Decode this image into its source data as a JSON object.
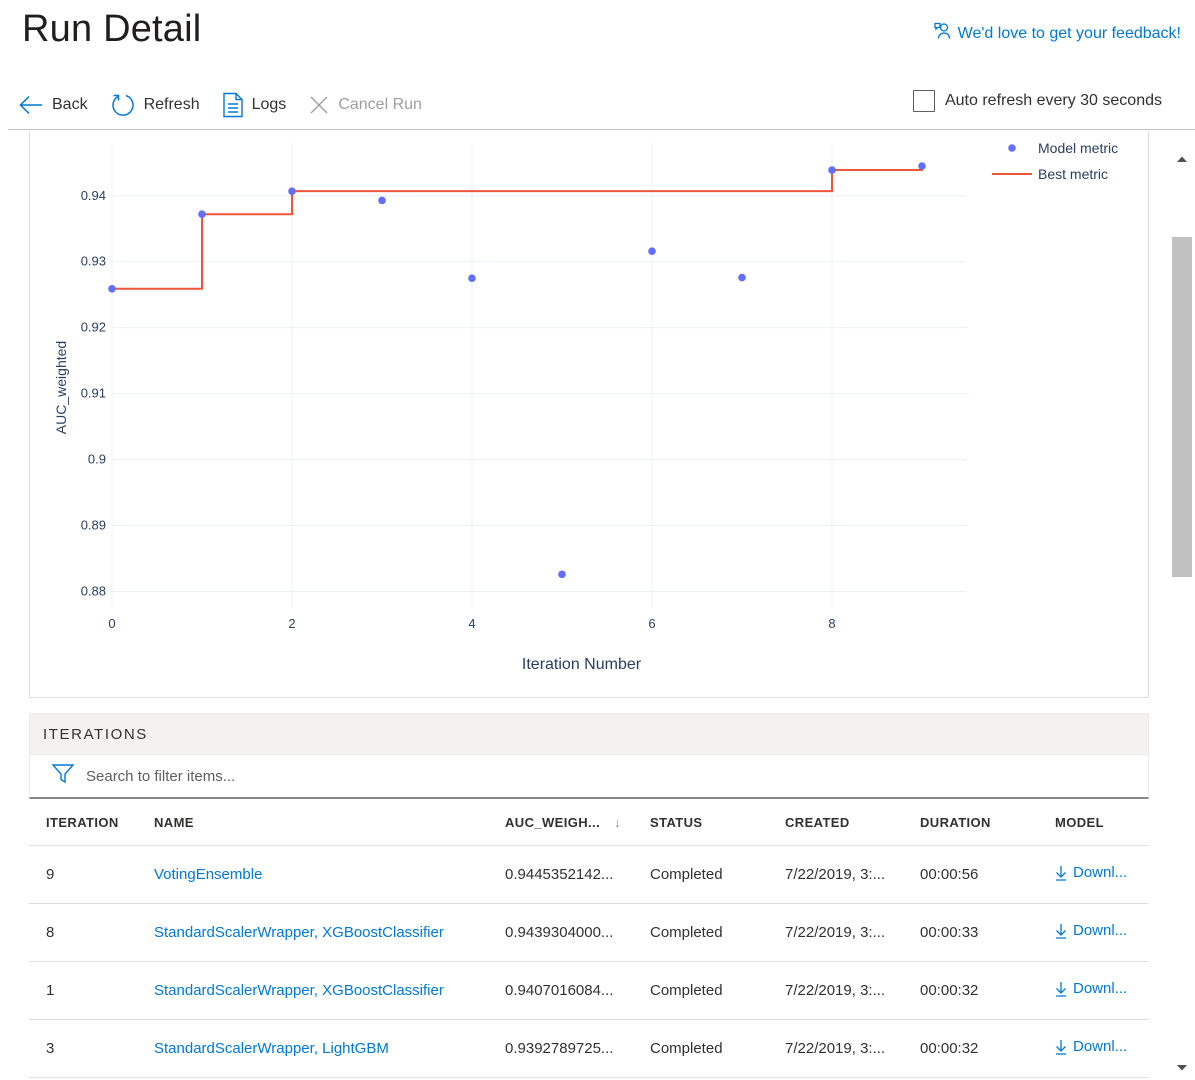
{
  "page": {
    "title": "Run Detail",
    "feedback": "We'd love to get your feedback!"
  },
  "toolbar": {
    "back": "Back",
    "refresh": "Refresh",
    "logs": "Logs",
    "cancel_run": "Cancel Run",
    "auto_refresh": "Auto refresh every 30 seconds",
    "auto_refresh_checked": false
  },
  "chart_data": {
    "type": "scatter",
    "xlabel": "Iteration Number",
    "ylabel": "AUC_weighted",
    "xlim": [
      0,
      9.5
    ],
    "ylim": [
      0.8775,
      0.948
    ],
    "xticks": [
      0,
      2,
      4,
      6,
      8
    ],
    "yticks": [
      0.88,
      0.89,
      0.9,
      0.91,
      0.92,
      0.93,
      0.94
    ],
    "grid": true,
    "legend_position": "top-right",
    "series": [
      {
        "name": "Model metric",
        "kind": "scatter",
        "color": "#636efa",
        "x": [
          0,
          1,
          2,
          3,
          4,
          5,
          6,
          7,
          8,
          9
        ],
        "y": [
          0.9259,
          0.9372,
          0.9407,
          0.9393,
          0.9275,
          0.8826,
          0.9316,
          0.9276,
          0.9439,
          0.9445
        ]
      },
      {
        "name": "Best metric",
        "kind": "step",
        "color": "#ef553b",
        "x": [
          0,
          1,
          2,
          3,
          4,
          5,
          6,
          7,
          8,
          9
        ],
        "y": [
          0.9259,
          0.9372,
          0.9407,
          0.9407,
          0.9407,
          0.9407,
          0.9407,
          0.9407,
          0.9439,
          0.9445
        ]
      }
    ]
  },
  "iterations": {
    "title": "ITERATIONS",
    "search_placeholder": "Search to filter items...",
    "columns": [
      "ITERATION",
      "NAME",
      "AUC_WEIGH...",
      "STATUS",
      "CREATED",
      "DURATION",
      "MODEL"
    ],
    "sort_indicator": "↓",
    "rows": [
      {
        "iteration": "9",
        "name": "VotingEnsemble",
        "auc": "0.9445352142...",
        "status": "Completed",
        "created": "7/22/2019, 3:...",
        "duration": "00:00:56",
        "model": "Downl..."
      },
      {
        "iteration": "8",
        "name": "StandardScalerWrapper, XGBoostClassifier",
        "auc": "0.9439304000...",
        "status": "Completed",
        "created": "7/22/2019, 3:...",
        "duration": "00:00:33",
        "model": "Downl..."
      },
      {
        "iteration": "1",
        "name": "StandardScalerWrapper, XGBoostClassifier",
        "auc": "0.9407016084...",
        "status": "Completed",
        "created": "7/22/2019, 3:...",
        "duration": "00:00:32",
        "model": "Downl..."
      },
      {
        "iteration": "3",
        "name": "StandardScalerWrapper, LightGBM",
        "auc": "0.9392789725...",
        "status": "Completed",
        "created": "7/22/2019, 3:...",
        "duration": "00:00:32",
        "model": "Downl..."
      }
    ]
  },
  "colors": {
    "accent": "#0078d4",
    "marker": "#636efa",
    "best_line": "#ef553b"
  }
}
